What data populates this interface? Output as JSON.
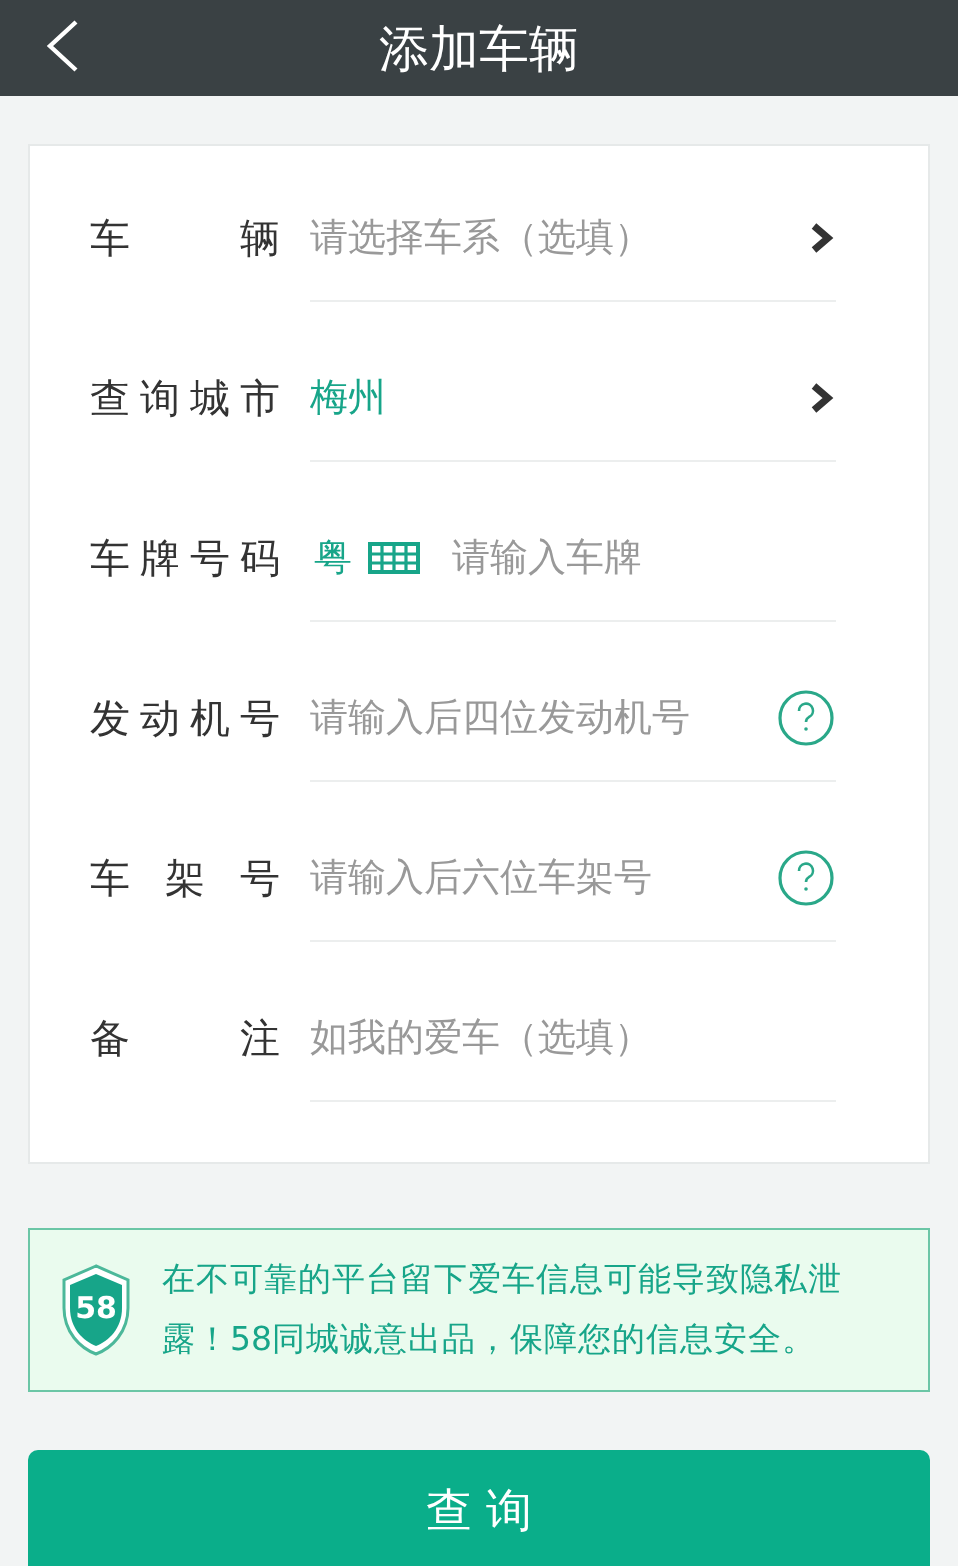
{
  "header": {
    "title": "添加车辆"
  },
  "form": [
    {
      "kind": "select",
      "label": "车 辆",
      "placeholder": "请选择车系（选填）"
    },
    {
      "kind": "select",
      "label": "查询城市",
      "value": "梅州"
    },
    {
      "kind": "plate",
      "label": "车牌号码",
      "prefix": "粤",
      "placeholder": "请输入车牌"
    },
    {
      "kind": "help",
      "label": "发动机号",
      "placeholder": "请输入后四位发动机号"
    },
    {
      "kind": "help",
      "label": "车 架 号",
      "placeholder": "请输入后六位车架号"
    },
    {
      "kind": "text",
      "label": "备 注",
      "placeholder": "如我的爱车（选填）"
    }
  ],
  "notice": {
    "badge": "58",
    "text": "在不可靠的平台留下爱车信息可能导致隐私泄露！58同城诚意出品，保障您的信息安全。"
  },
  "submit": {
    "label": "查 询"
  }
}
